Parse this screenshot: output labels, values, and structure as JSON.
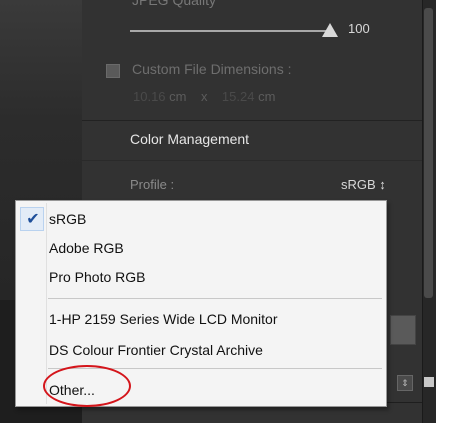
{
  "export_panel": {
    "quality_label": "JPEG Quality",
    "quality_value": "100",
    "custom_dims_label": "Custom File Dimensions :",
    "width_value": "10.16",
    "width_unit": "cm",
    "times": "x",
    "height_value": "15.24",
    "height_unit": "cm",
    "section_title": "Color Management",
    "profile_label": "Profile :",
    "profile_value": "sRGB ↕"
  },
  "profile_menu": {
    "items": [
      {
        "label": "sRGB",
        "checked": true
      },
      {
        "label": "Adobe RGB",
        "checked": false
      },
      {
        "label": "Pro Photo RGB",
        "checked": false
      },
      {
        "label": "1-HP 2159 Series Wide LCD Monitor",
        "checked": false
      },
      {
        "label": "DS Colour  Frontier Crystal Archive",
        "checked": false
      },
      {
        "label": "Other...",
        "checked": false
      }
    ],
    "check_glyph": "✔"
  },
  "colors": {
    "panel_bg": "#323232",
    "menu_bg": "#f4f4f4",
    "highlight_circle": "#d4151b",
    "check_color": "#1e4f9a"
  }
}
